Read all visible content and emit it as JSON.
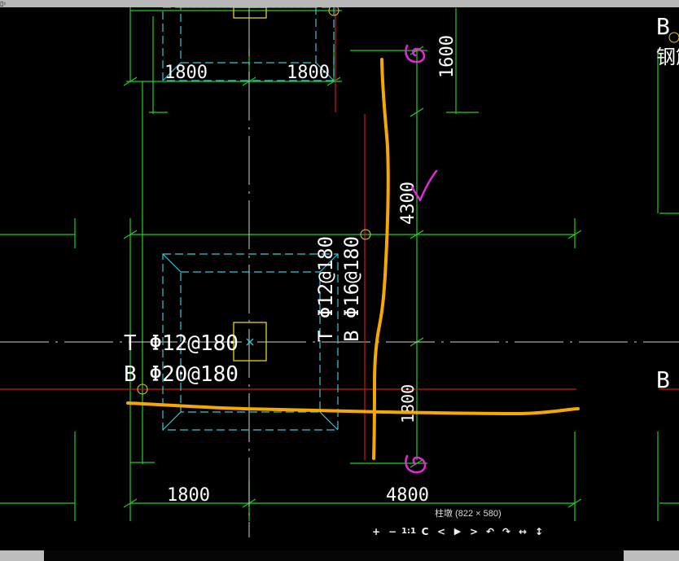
{
  "drawing": {
    "dims": {
      "top_left": "1800",
      "top_right": "1800",
      "right_top": "1600",
      "right_mid": "4300",
      "right_low": "1800",
      "bottom_left": "1800",
      "bottom_right": "4800"
    },
    "rebar_left": {
      "top": "T Φ12@180",
      "bottom": "B Φ20@180"
    },
    "rebar_center": {
      "top": "T Φ12@180",
      "bottom": "B Φ16@180"
    },
    "edge_right": {
      "b1": "B",
      "cjk": "钢筋",
      "b2": "B"
    }
  },
  "image_caption": "柱墩 (822 × 580)",
  "toolbar": {
    "zoom_in": "+",
    "zoom_out": "−",
    "actual_size": "1:1",
    "refresh": "C",
    "prev": "<",
    "play": "▶",
    "next": ">",
    "rotate_left": "↶",
    "rotate_right": "↷",
    "fit_width": "↔",
    "fit_height": "↕"
  },
  "colors": {
    "background": "#000000",
    "dim_line": "#1fd01f",
    "axis": "#e6e6e6",
    "pier_outline": "#35c8d8",
    "column": "#e6d21c",
    "red_line": "#d01818",
    "markup_orange": "#f5a800",
    "markup_magenta": "#e22ad8"
  }
}
